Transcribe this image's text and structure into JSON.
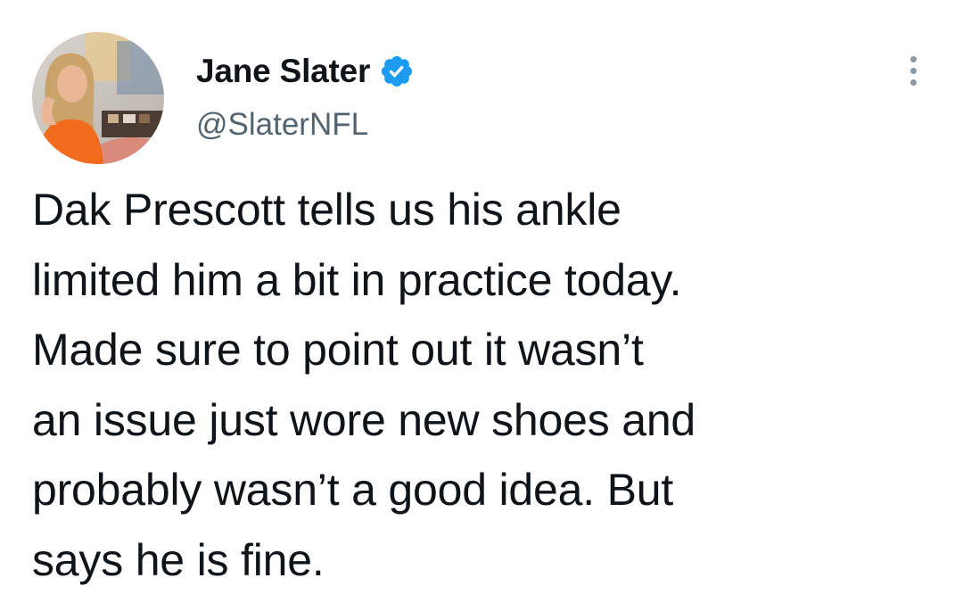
{
  "tweet": {
    "author": {
      "display_name": "Jane Slater",
      "handle": "@SlaterNFL",
      "verified": true,
      "avatar_icon": "avatar-photo",
      "verified_icon": "verified-badge-icon",
      "verified_color": "#1d9bf0"
    },
    "more_icon": "more-options-icon",
    "text_lines": [
      "Dak Prescott tells us his ankle",
      "limited him a bit in practice today.",
      "Made sure to point out it wasn’t",
      "an issue just wore new shoes and",
      "probably wasn’t a good idea. But",
      "says he is fine."
    ]
  }
}
